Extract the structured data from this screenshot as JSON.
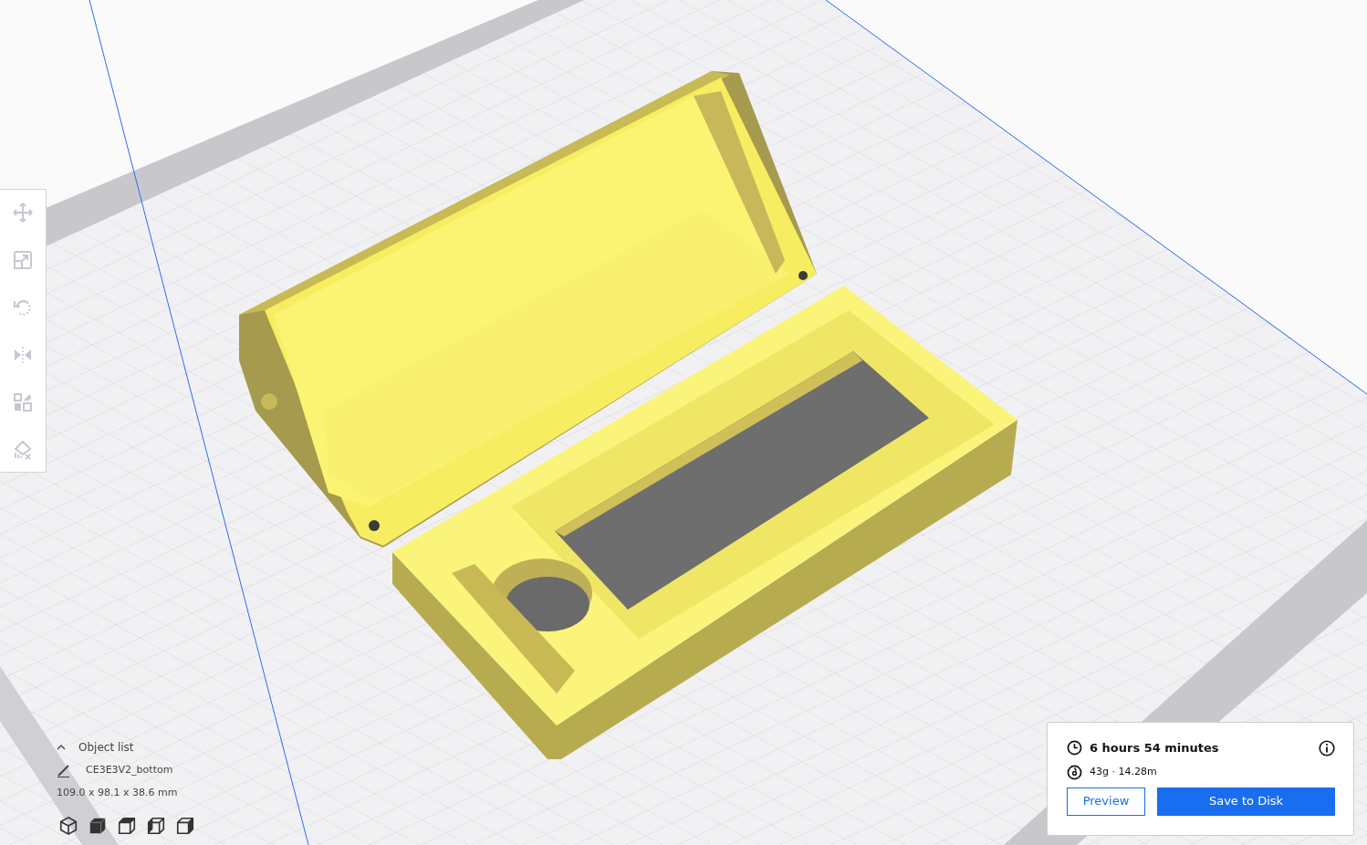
{
  "toolbar": {
    "tools": [
      {
        "kind": "move",
        "disabled": true
      },
      {
        "kind": "scale",
        "disabled": true
      },
      {
        "kind": "rotate",
        "disabled": true
      },
      {
        "kind": "mirror",
        "disabled": true
      },
      {
        "kind": "per-model",
        "disabled": true
      },
      {
        "kind": "support-blocker",
        "disabled": true
      }
    ]
  },
  "object_list": {
    "title": "Object list",
    "expanded": true,
    "object_name": "CE3E3V2_bottom",
    "dimensions": "109.0 x 98.1 x 38.6 mm",
    "view_buttons": [
      {
        "kind": "isometric"
      },
      {
        "kind": "front"
      },
      {
        "kind": "top"
      },
      {
        "kind": "left"
      },
      {
        "kind": "right"
      }
    ]
  },
  "print_panel": {
    "time": "6 hours 54 minutes",
    "material": "43g · 14.28m",
    "buttons": [
      {
        "label": "Preview",
        "kind": "outline"
      },
      {
        "label": "Save to Disk",
        "kind": "primary"
      }
    ]
  }
}
